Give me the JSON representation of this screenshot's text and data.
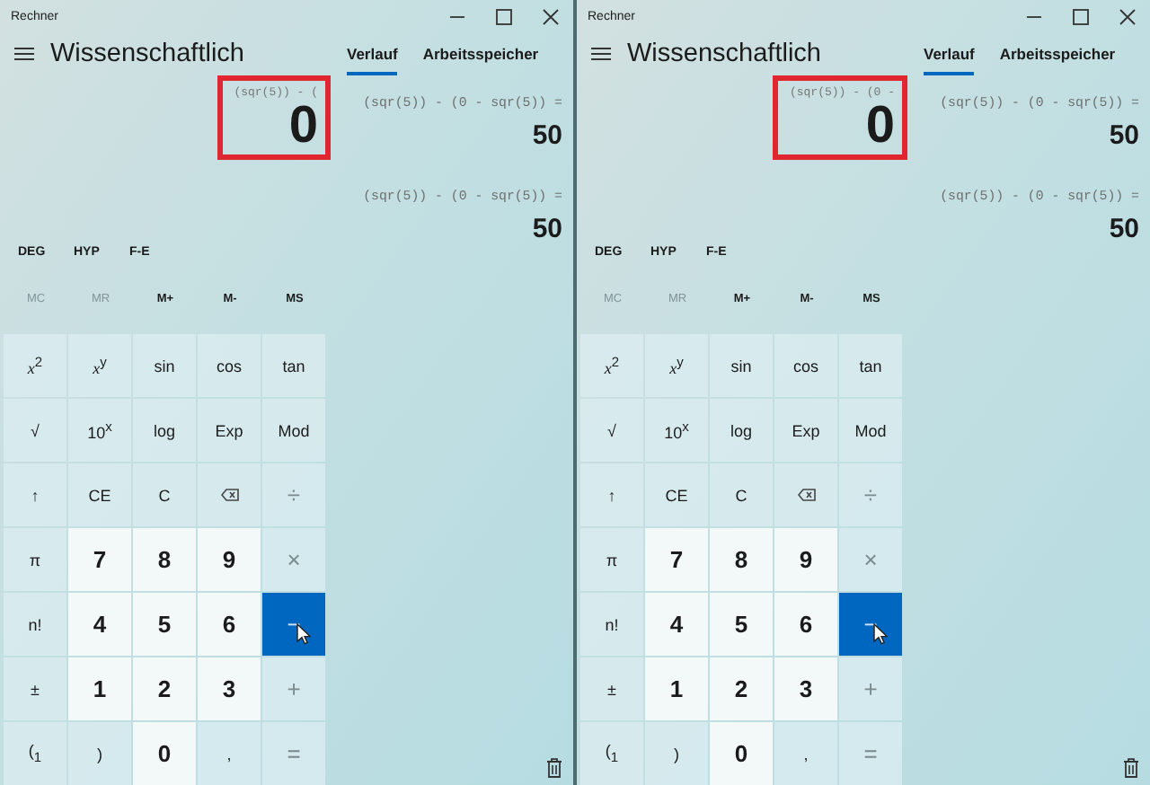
{
  "windows": [
    {
      "title": "Rechner",
      "mode": "Wissenschaftlich",
      "tabs": [
        {
          "label": "Verlauf",
          "selected": true
        },
        {
          "label": "Arbeitsspeicher",
          "selected": false
        }
      ],
      "display": {
        "expression": "(sqr(5)) - (",
        "value": "0",
        "highlighted": true
      },
      "history": [
        {
          "expression": "(sqr(5)) - (0 - sqr(5)) =",
          "result": "50"
        },
        {
          "expression": "(sqr(5)) - (0 - sqr(5)) =",
          "result": "50"
        }
      ],
      "modes": [
        "DEG",
        "HYP",
        "F-E"
      ],
      "memory": [
        {
          "label": "MC",
          "disabled": true
        },
        {
          "label": "MR",
          "disabled": true
        },
        {
          "label": "M+",
          "disabled": false
        },
        {
          "label": "M-",
          "disabled": false
        },
        {
          "label": "MS",
          "disabled": false
        }
      ],
      "keys": [
        {
          "label": "*x*$^{2}$",
          "kind": "fn",
          "pressed": false
        },
        {
          "label": "*x*$^{y}$",
          "kind": "fn",
          "pressed": false
        },
        {
          "label": "sin",
          "kind": "fn",
          "pressed": false
        },
        {
          "label": "cos",
          "kind": "fn",
          "pressed": false
        },
        {
          "label": "tan",
          "kind": "fn",
          "pressed": false
        },
        {
          "label": "√",
          "kind": "fn",
          "pressed": false
        },
        {
          "label": "10$^{x}$",
          "kind": "fn",
          "pressed": false
        },
        {
          "label": "log",
          "kind": "fn",
          "pressed": false
        },
        {
          "label": "Exp",
          "kind": "fn",
          "pressed": false
        },
        {
          "label": "Mod",
          "kind": "fn",
          "pressed": false
        },
        {
          "label": "↑",
          "kind": "fn",
          "pressed": false
        },
        {
          "label": "CE",
          "kind": "fn",
          "pressed": false
        },
        {
          "label": "C",
          "kind": "fn",
          "pressed": false
        },
        {
          "kind": "backspace",
          "pressed": false
        },
        {
          "label": "÷",
          "kind": "op",
          "pressed": false
        },
        {
          "label": "π",
          "kind": "fn",
          "pressed": false
        },
        {
          "label": "7",
          "kind": "num",
          "pressed": false
        },
        {
          "label": "8",
          "kind": "num",
          "pressed": false
        },
        {
          "label": "9",
          "kind": "num",
          "pressed": false
        },
        {
          "label": "×",
          "kind": "op",
          "pressed": false
        },
        {
          "label": "n!",
          "kind": "fn",
          "pressed": false
        },
        {
          "label": "4",
          "kind": "num",
          "pressed": false
        },
        {
          "label": "5",
          "kind": "num",
          "pressed": false
        },
        {
          "label": "6",
          "kind": "num",
          "pressed": false
        },
        {
          "label": "−",
          "kind": "op",
          "pressed": true
        },
        {
          "label": "±",
          "kind": "fn",
          "pressed": false
        },
        {
          "label": "1",
          "kind": "num",
          "pressed": false
        },
        {
          "label": "2",
          "kind": "num",
          "pressed": false
        },
        {
          "label": "3",
          "kind": "num",
          "pressed": false
        },
        {
          "label": "+",
          "kind": "op",
          "pressed": false
        },
        {
          "label": "($_{1}$",
          "kind": "fn",
          "pressed": false
        },
        {
          "label": ")",
          "kind": "fn",
          "pressed": false
        },
        {
          "label": "0",
          "kind": "num",
          "pressed": false
        },
        {
          "label": ",",
          "kind": "fn",
          "pressed": false
        },
        {
          "label": "=",
          "kind": "op",
          "pressed": false
        }
      ]
    },
    {
      "title": "Rechner",
      "mode": "Wissenschaftlich",
      "tabs": [
        {
          "label": "Verlauf",
          "selected": true
        },
        {
          "label": "Arbeitsspeicher",
          "selected": false
        }
      ],
      "display": {
        "expression": "(sqr(5)) - (0 -",
        "value": "0",
        "highlighted": true
      },
      "history": [
        {
          "expression": "(sqr(5)) - (0 - sqr(5)) =",
          "result": "50"
        },
        {
          "expression": "(sqr(5)) - (0 - sqr(5)) =",
          "result": "50"
        }
      ],
      "modes": [
        "DEG",
        "HYP",
        "F-E"
      ],
      "memory": [
        {
          "label": "MC",
          "disabled": true
        },
        {
          "label": "MR",
          "disabled": true
        },
        {
          "label": "M+",
          "disabled": false
        },
        {
          "label": "M-",
          "disabled": false
        },
        {
          "label": "MS",
          "disabled": false
        }
      ],
      "keys": [
        {
          "label": "*x*$^{2}$",
          "kind": "fn",
          "pressed": false
        },
        {
          "label": "*x*$^{y}$",
          "kind": "fn",
          "pressed": false
        },
        {
          "label": "sin",
          "kind": "fn",
          "pressed": false
        },
        {
          "label": "cos",
          "kind": "fn",
          "pressed": false
        },
        {
          "label": "tan",
          "kind": "fn",
          "pressed": false
        },
        {
          "label": "√",
          "kind": "fn",
          "pressed": false
        },
        {
          "label": "10$^{x}$",
          "kind": "fn",
          "pressed": false
        },
        {
          "label": "log",
          "kind": "fn",
          "pressed": false
        },
        {
          "label": "Exp",
          "kind": "fn",
          "pressed": false
        },
        {
          "label": "Mod",
          "kind": "fn",
          "pressed": false
        },
        {
          "label": "↑",
          "kind": "fn",
          "pressed": false
        },
        {
          "label": "CE",
          "kind": "fn",
          "pressed": false
        },
        {
          "label": "C",
          "kind": "fn",
          "pressed": false
        },
        {
          "kind": "backspace",
          "pressed": false
        },
        {
          "label": "÷",
          "kind": "op",
          "pressed": false
        },
        {
          "label": "π",
          "kind": "fn",
          "pressed": false
        },
        {
          "label": "7",
          "kind": "num",
          "pressed": false
        },
        {
          "label": "8",
          "kind": "num",
          "pressed": false
        },
        {
          "label": "9",
          "kind": "num",
          "pressed": false
        },
        {
          "label": "×",
          "kind": "op",
          "pressed": false
        },
        {
          "label": "n!",
          "kind": "fn",
          "pressed": false
        },
        {
          "label": "4",
          "kind": "num",
          "pressed": false
        },
        {
          "label": "5",
          "kind": "num",
          "pressed": false
        },
        {
          "label": "6",
          "kind": "num",
          "pressed": false
        },
        {
          "label": "−",
          "kind": "op",
          "pressed": true
        },
        {
          "label": "±",
          "kind": "fn",
          "pressed": false
        },
        {
          "label": "1",
          "kind": "num",
          "pressed": false
        },
        {
          "label": "2",
          "kind": "num",
          "pressed": false
        },
        {
          "label": "3",
          "kind": "num",
          "pressed": false
        },
        {
          "label": "+",
          "kind": "op",
          "pressed": false
        },
        {
          "label": "($_{1}$",
          "kind": "fn",
          "pressed": false
        },
        {
          "label": ")",
          "kind": "fn",
          "pressed": false
        },
        {
          "label": "0",
          "kind": "num",
          "pressed": false
        },
        {
          "label": ",",
          "kind": "fn",
          "pressed": false
        },
        {
          "label": "=",
          "kind": "op",
          "pressed": false
        }
      ]
    }
  ]
}
